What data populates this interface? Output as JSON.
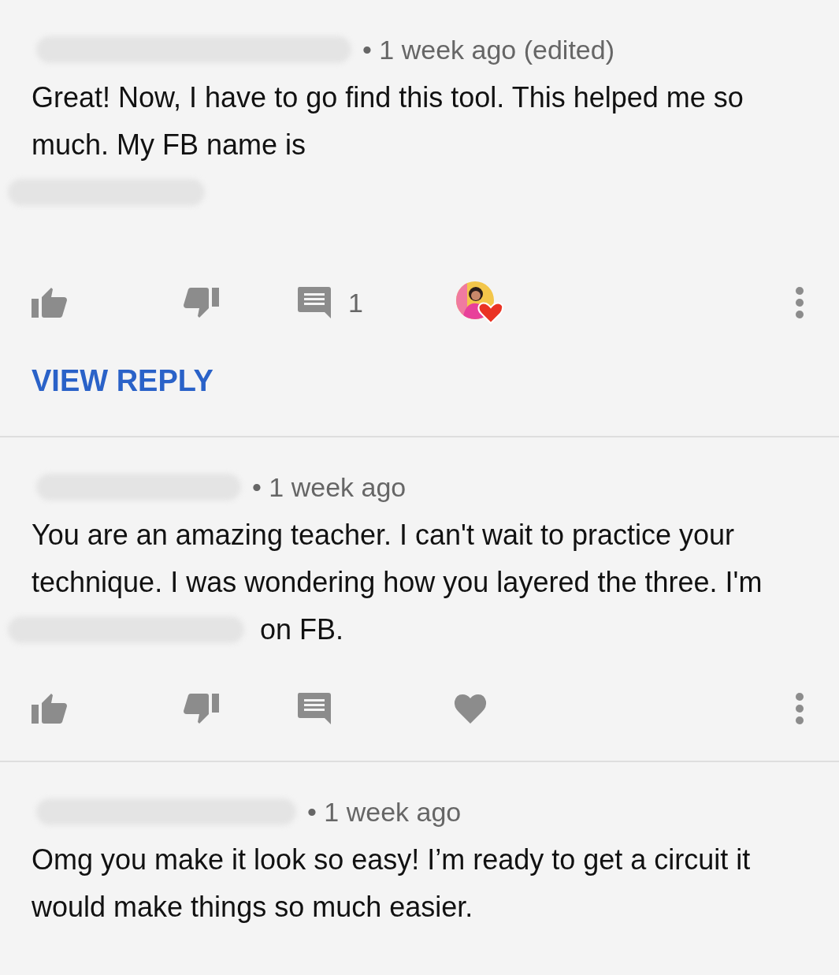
{
  "comments": [
    {
      "meta": "• 1 week ago (edited)",
      "body": [
        {
          "kind": "text",
          "text": "Great! Now, I have to go find this tool. This helped me so much. My FB name is"
        },
        {
          "kind": "redacted"
        }
      ],
      "reply_count": "1",
      "creator_hearted": true,
      "view_reply": "VIEW REPLY"
    },
    {
      "meta": "• 1 week ago",
      "body": [
        {
          "kind": "text",
          "text": "You are an amazing teacher. I can't wait to practice your technique. I was wondering how you layered the three. I'm"
        },
        {
          "kind": "redacted"
        },
        {
          "kind": "text",
          "text": "on FB."
        }
      ],
      "creator_hearted": false
    },
    {
      "meta": "• 1 week ago",
      "body": [
        {
          "kind": "text",
          "text": "Omg you make it look so easy! I’m ready to get a circuit it would make things so much easier."
        }
      ]
    }
  ]
}
